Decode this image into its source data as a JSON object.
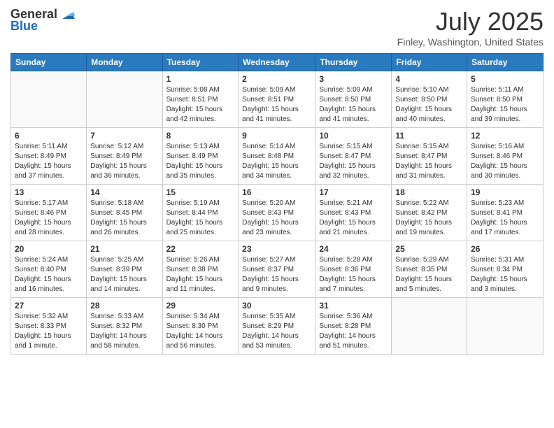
{
  "logo": {
    "line1": "General",
    "line2": "Blue"
  },
  "title": "July 2025",
  "location": "Finley, Washington, United States",
  "weekdays": [
    "Sunday",
    "Monday",
    "Tuesday",
    "Wednesday",
    "Thursday",
    "Friday",
    "Saturday"
  ],
  "weeks": [
    [
      {
        "day": "",
        "content": ""
      },
      {
        "day": "",
        "content": ""
      },
      {
        "day": "1",
        "content": "Sunrise: 5:08 AM\nSunset: 8:51 PM\nDaylight: 15 hours\nand 42 minutes."
      },
      {
        "day": "2",
        "content": "Sunrise: 5:09 AM\nSunset: 8:51 PM\nDaylight: 15 hours\nand 41 minutes."
      },
      {
        "day": "3",
        "content": "Sunrise: 5:09 AM\nSunset: 8:50 PM\nDaylight: 15 hours\nand 41 minutes."
      },
      {
        "day": "4",
        "content": "Sunrise: 5:10 AM\nSunset: 8:50 PM\nDaylight: 15 hours\nand 40 minutes."
      },
      {
        "day": "5",
        "content": "Sunrise: 5:11 AM\nSunset: 8:50 PM\nDaylight: 15 hours\nand 39 minutes."
      }
    ],
    [
      {
        "day": "6",
        "content": "Sunrise: 5:11 AM\nSunset: 8:49 PM\nDaylight: 15 hours\nand 37 minutes."
      },
      {
        "day": "7",
        "content": "Sunrise: 5:12 AM\nSunset: 8:49 PM\nDaylight: 15 hours\nand 36 minutes."
      },
      {
        "day": "8",
        "content": "Sunrise: 5:13 AM\nSunset: 8:49 PM\nDaylight: 15 hours\nand 35 minutes."
      },
      {
        "day": "9",
        "content": "Sunrise: 5:14 AM\nSunset: 8:48 PM\nDaylight: 15 hours\nand 34 minutes."
      },
      {
        "day": "10",
        "content": "Sunrise: 5:15 AM\nSunset: 8:47 PM\nDaylight: 15 hours\nand 32 minutes."
      },
      {
        "day": "11",
        "content": "Sunrise: 5:15 AM\nSunset: 8:47 PM\nDaylight: 15 hours\nand 31 minutes."
      },
      {
        "day": "12",
        "content": "Sunrise: 5:16 AM\nSunset: 8:46 PM\nDaylight: 15 hours\nand 30 minutes."
      }
    ],
    [
      {
        "day": "13",
        "content": "Sunrise: 5:17 AM\nSunset: 8:46 PM\nDaylight: 15 hours\nand 28 minutes."
      },
      {
        "day": "14",
        "content": "Sunrise: 5:18 AM\nSunset: 8:45 PM\nDaylight: 15 hours\nand 26 minutes."
      },
      {
        "day": "15",
        "content": "Sunrise: 5:19 AM\nSunset: 8:44 PM\nDaylight: 15 hours\nand 25 minutes."
      },
      {
        "day": "16",
        "content": "Sunrise: 5:20 AM\nSunset: 8:43 PM\nDaylight: 15 hours\nand 23 minutes."
      },
      {
        "day": "17",
        "content": "Sunrise: 5:21 AM\nSunset: 8:43 PM\nDaylight: 15 hours\nand 21 minutes."
      },
      {
        "day": "18",
        "content": "Sunrise: 5:22 AM\nSunset: 8:42 PM\nDaylight: 15 hours\nand 19 minutes."
      },
      {
        "day": "19",
        "content": "Sunrise: 5:23 AM\nSunset: 8:41 PM\nDaylight: 15 hours\nand 17 minutes."
      }
    ],
    [
      {
        "day": "20",
        "content": "Sunrise: 5:24 AM\nSunset: 8:40 PM\nDaylight: 15 hours\nand 16 minutes."
      },
      {
        "day": "21",
        "content": "Sunrise: 5:25 AM\nSunset: 8:39 PM\nDaylight: 15 hours\nand 14 minutes."
      },
      {
        "day": "22",
        "content": "Sunrise: 5:26 AM\nSunset: 8:38 PM\nDaylight: 15 hours\nand 11 minutes."
      },
      {
        "day": "23",
        "content": "Sunrise: 5:27 AM\nSunset: 8:37 PM\nDaylight: 15 hours\nand 9 minutes."
      },
      {
        "day": "24",
        "content": "Sunrise: 5:28 AM\nSunset: 8:36 PM\nDaylight: 15 hours\nand 7 minutes."
      },
      {
        "day": "25",
        "content": "Sunrise: 5:29 AM\nSunset: 8:35 PM\nDaylight: 15 hours\nand 5 minutes."
      },
      {
        "day": "26",
        "content": "Sunrise: 5:31 AM\nSunset: 8:34 PM\nDaylight: 15 hours\nand 3 minutes."
      }
    ],
    [
      {
        "day": "27",
        "content": "Sunrise: 5:32 AM\nSunset: 8:33 PM\nDaylight: 15 hours\nand 1 minute."
      },
      {
        "day": "28",
        "content": "Sunrise: 5:33 AM\nSunset: 8:32 PM\nDaylight: 14 hours\nand 58 minutes."
      },
      {
        "day": "29",
        "content": "Sunrise: 5:34 AM\nSunset: 8:30 PM\nDaylight: 14 hours\nand 56 minutes."
      },
      {
        "day": "30",
        "content": "Sunrise: 5:35 AM\nSunset: 8:29 PM\nDaylight: 14 hours\nand 53 minutes."
      },
      {
        "day": "31",
        "content": "Sunrise: 5:36 AM\nSunset: 8:28 PM\nDaylight: 14 hours\nand 51 minutes."
      },
      {
        "day": "",
        "content": ""
      },
      {
        "day": "",
        "content": ""
      }
    ]
  ]
}
